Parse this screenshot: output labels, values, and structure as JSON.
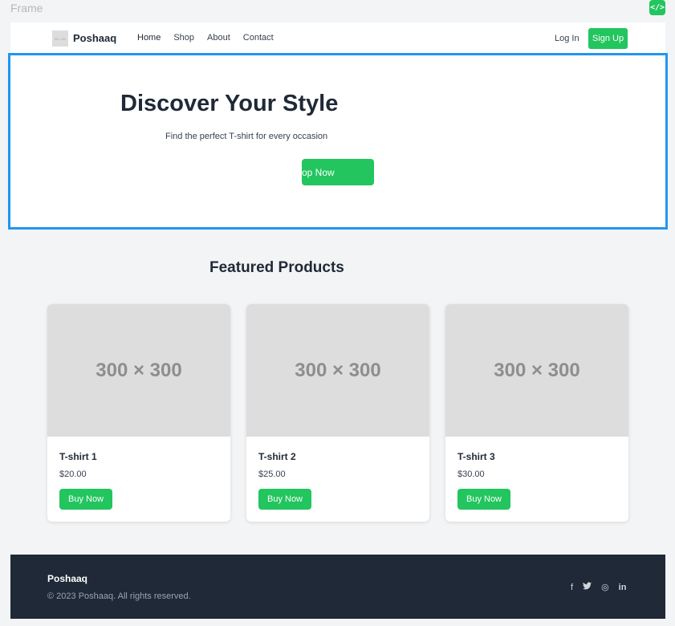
{
  "frame": {
    "label": "Frame",
    "code_icon": "</>"
  },
  "nav": {
    "logo_placeholder": "50 × 50",
    "brand": "Poshaaq",
    "links": [
      "Home",
      "Shop",
      "About",
      "Contact"
    ],
    "login": "Log In",
    "signup": "Sign Up"
  },
  "hero": {
    "title": "Discover Your Style",
    "subtitle": "Find the perfect T-shirt for every occasion",
    "button": "op Now"
  },
  "featured": {
    "title": "Featured Products",
    "products": [
      {
        "image": "300 × 300",
        "name": "T-shirt 1",
        "price": "$20.00",
        "button": "Buy Now"
      },
      {
        "image": "300 × 300",
        "name": "T-shirt 2",
        "price": "$25.00",
        "button": "Buy Now"
      },
      {
        "image": "300 × 300",
        "name": "T-shirt 3",
        "price": "$30.00",
        "button": "Buy Now"
      }
    ]
  },
  "footer": {
    "brand": "Poshaaq",
    "copyright": "© 2023 Poshaaq. All rights reserved.",
    "socials": {
      "facebook": "f",
      "twitter": "🐦",
      "instagram": "◎",
      "linkedin": "in"
    }
  },
  "colors": {
    "accent": "#22c55e",
    "selection": "#2196f3",
    "footer_bg": "#1f2937",
    "page_bg": "#f3f4f6"
  }
}
